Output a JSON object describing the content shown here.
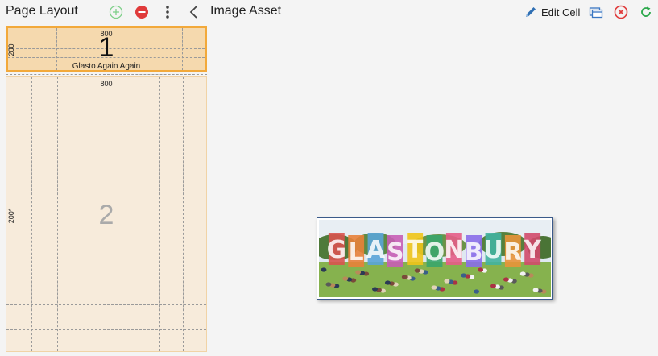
{
  "header": {
    "page_layout_title": "Page Layout",
    "image_asset_title": "Image Asset",
    "edit_cell_label": "Edit Cell"
  },
  "layout": {
    "cells": [
      {
        "number": "1",
        "width_label": "800",
        "height_label": "200",
        "name": "Glasto Again Again"
      },
      {
        "number": "2",
        "width_label": "800",
        "height_label": "200*"
      }
    ]
  },
  "image": {
    "letters": [
      "G",
      "L",
      "A",
      "S",
      "T",
      "O",
      "N",
      "B",
      "U",
      "R",
      "Y"
    ],
    "letter_colors": [
      "#d9534f",
      "#e8813a",
      "#5aa4d8",
      "#c65db5",
      "#f0c419",
      "#3aa56b",
      "#e55d87",
      "#8a6de9",
      "#42b3a0",
      "#e9943a",
      "#d24a6b"
    ]
  },
  "colors": {
    "accent_orange": "#f2a93b",
    "add_green": "#5fc46a",
    "remove_red": "#e03b3b",
    "edit_blue": "#2f6fb3",
    "refresh_green": "#2aa84a"
  }
}
